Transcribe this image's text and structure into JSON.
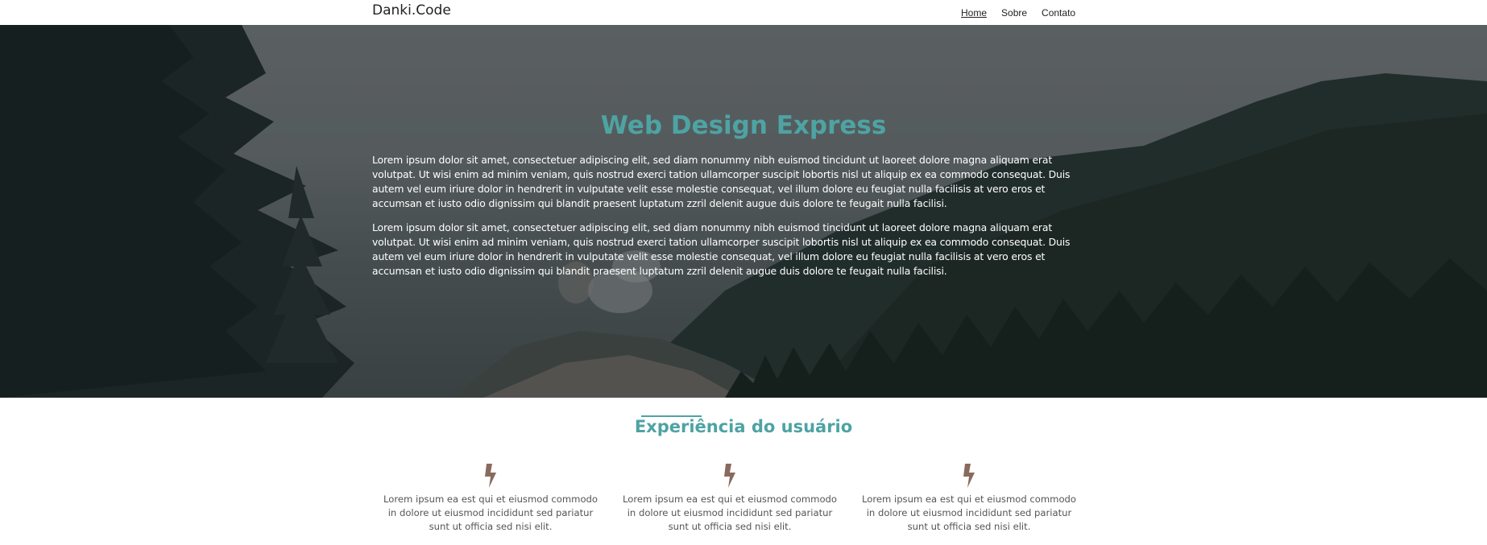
{
  "header": {
    "brand": "Danki.Code",
    "nav": [
      {
        "label": "Home",
        "active": true
      },
      {
        "label": "Sobre",
        "active": false
      },
      {
        "label": "Contato",
        "active": false
      }
    ]
  },
  "hero": {
    "title": "Web Design Express",
    "paragraphs": [
      "Lorem ipsum dolor sit amet, consectetuer adipiscing elit, sed diam nonummy nibh euismod tincidunt ut laoreet dolore magna aliquam erat volutpat. Ut wisi enim ad minim veniam, quis nostrud exerci tation ullamcorper suscipit lobortis nisl ut aliquip ex ea commodo consequat. Duis autem vel eum iriure dolor in hendrerit in vulputate velit esse molestie consequat, vel illum dolore eu feugiat nulla facilisis at vero eros et accumsan et iusto odio dignissim qui blandit praesent luptatum zzril delenit augue duis dolore te feugait nulla facilisi.",
      "Lorem ipsum dolor sit amet, consectetuer adipiscing elit, sed diam nonummy nibh euismod tincidunt ut laoreet dolore magna aliquam erat volutpat. Ut wisi enim ad minim veniam, quis nostrud exerci tation ullamcorper suscipit lobortis nisl ut aliquip ex ea commodo consequat. Duis autem vel eum iriure dolor in hendrerit in vulputate velit esse molestie consequat, vel illum dolore eu feugiat nulla facilisis at vero eros et accumsan et iusto odio dignissim qui blandit praesent luptatum zzril delenit augue duis dolore te feugait nulla facilisi."
    ]
  },
  "experience": {
    "title": "Experiência do usuário",
    "features": [
      {
        "icon": "bolt-icon",
        "text": "Lorem ipsum ea est qui et eiusmod commodo in dolore ut eiusmod incididunt sed pariatur sunt ut officia sed nisi elit."
      },
      {
        "icon": "bolt-icon",
        "text": "Lorem ipsum ea est qui et eiusmod commodo in dolore ut eiusmod incididunt sed pariatur sunt ut officia sed nisi elit."
      },
      {
        "icon": "bolt-icon",
        "text": "Lorem ipsum ea est qui et eiusmod commodo in dolore ut eiusmod incididunt sed pariatur sunt ut officia sed nisi elit."
      }
    ]
  },
  "colors": {
    "accent": "#4ea3a3",
    "icon": "#8a6a5e"
  }
}
